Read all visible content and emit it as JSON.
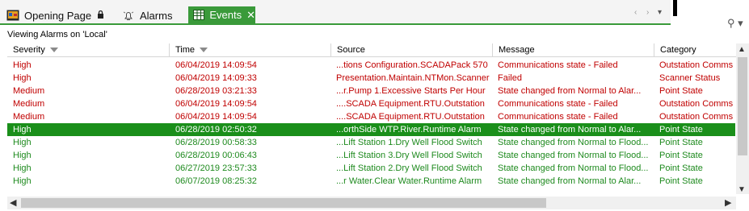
{
  "tabs": [
    {
      "label": "Opening Page",
      "locked": true
    },
    {
      "label": "Alarms"
    },
    {
      "label": "Events",
      "active": true
    }
  ],
  "tabnav": {
    "left": "‹",
    "right": "›",
    "menu": "▾"
  },
  "search_icon": "⚲ ▾",
  "grid": {
    "title": "Viewing Alarms on 'Local'",
    "columns": [
      "Severity",
      "Time",
      "Source",
      "Message",
      "Category"
    ],
    "rows": [
      {
        "severity": "High",
        "time": "06/04/2019 14:09:54",
        "source": "...tions Configuration.SCADAPack 570",
        "message": "Communications state - Failed",
        "category": "Outstation Comms",
        "color": "#c00000"
      },
      {
        "severity": "High",
        "time": "06/04/2019 14:09:33",
        "source": "Presentation.Maintain.NTMon.Scanner",
        "message": "Failed",
        "category": "Scanner Status",
        "color": "#c00000"
      },
      {
        "severity": "Medium",
        "time": "06/28/2019 03:21:33",
        "source": "...r.Pump 1.Excessive Starts Per Hour",
        "message": "State changed from Normal to Alar...",
        "category": "Point State",
        "color": "#c00000"
      },
      {
        "severity": "Medium",
        "time": "06/04/2019 14:09:54",
        "source": "....SCADA Equipment.RTU.Outstation",
        "message": "Communications state - Failed",
        "category": "Outstation Comms",
        "color": "#c00000"
      },
      {
        "severity": "Medium",
        "time": "06/04/2019 14:09:54",
        "source": "....SCADA Equipment.RTU.Outstation",
        "message": "Communications state - Failed",
        "category": "Outstation Comms",
        "color": "#c00000"
      },
      {
        "severity": "High",
        "time": "06/28/2019 02:50:32",
        "source": "...orthSide WTP.River.Runtime Alarm",
        "message": "State changed from Normal to Alar...",
        "category": "Point State",
        "color": "#ffffff",
        "selected": true
      },
      {
        "severity": "High",
        "time": "06/28/2019 00:58:33",
        "source": "...Lift Station 1.Dry Well Flood Switch",
        "message": "State changed from Normal to Flood...",
        "category": "Point State",
        "color": "#1e8a1e"
      },
      {
        "severity": "High",
        "time": "06/28/2019 00:06:43",
        "source": "...Lift Station 3.Dry Well Flood Switch",
        "message": "State changed from Normal to Flood...",
        "category": "Point State",
        "color": "#1e8a1e"
      },
      {
        "severity": "High",
        "time": "06/27/2019 23:57:33",
        "source": "...Lift Station 2.Dry Well Flood Switch",
        "message": "State changed from Normal to Flood...",
        "category": "Point State",
        "color": "#1e8a1e"
      },
      {
        "severity": "High",
        "time": "06/07/2019 08:25:32",
        "source": "...r Water.Clear Water.Runtime Alarm",
        "message": "State changed from Normal to Alar...",
        "category": "Point State",
        "color": "#1e8a1e"
      }
    ]
  }
}
